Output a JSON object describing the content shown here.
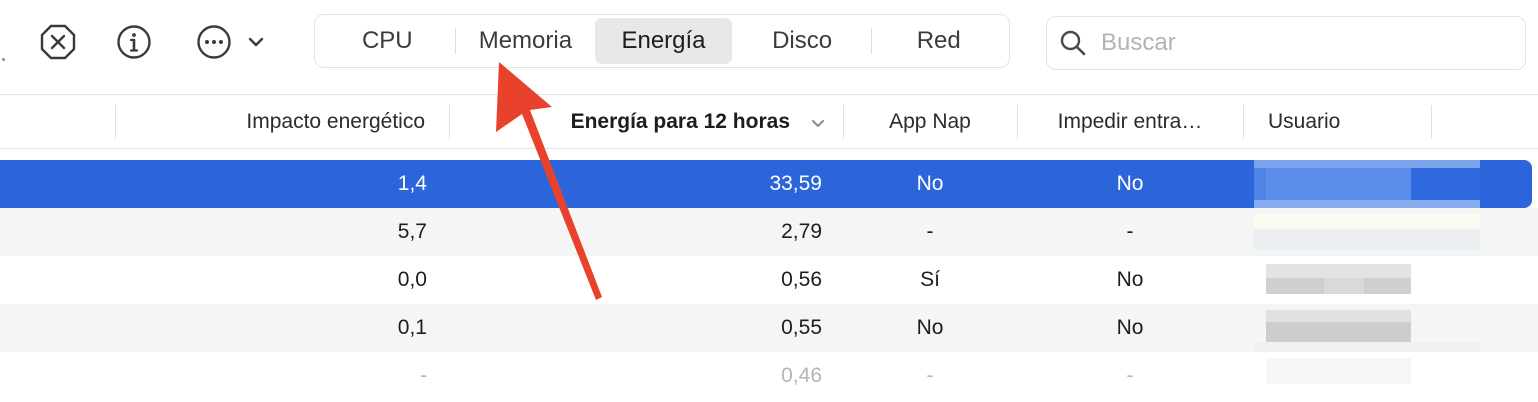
{
  "toolbar": {
    "stop_icon": "stop-process-icon",
    "info_icon": "info-icon",
    "more_icon": "more-icon",
    "tabs": [
      {
        "label": "CPU",
        "active": false
      },
      {
        "label": "Memoria",
        "active": false
      },
      {
        "label": "Energía",
        "active": true
      },
      {
        "label": "Disco",
        "active": false
      },
      {
        "label": "Red",
        "active": false
      }
    ],
    "search_placeholder": "Buscar"
  },
  "table": {
    "columns": {
      "energy_impact": "Impacto energético",
      "energy_12h": "Energía para 12 horas",
      "app_nap": "App Nap",
      "prevent_sleep": "Impedir entra…",
      "user": "Usuario"
    },
    "rows": [
      {
        "impact": "1,4",
        "energy": "33,59",
        "app_nap": "No",
        "prevent": "No"
      },
      {
        "impact": "5,7",
        "energy": "2,79",
        "app_nap": "-",
        "prevent": "-"
      },
      {
        "impact": "0,0",
        "energy": "0,56",
        "app_nap": "Sí",
        "prevent": "No"
      },
      {
        "impact": "0,1",
        "energy": "0,55",
        "app_nap": "No",
        "prevent": "No"
      },
      {
        "impact": "-",
        "energy": "0,46",
        "app_nap": "-",
        "prevent": "-"
      }
    ]
  },
  "colors": {
    "selection": "#2b65d9",
    "annotation_arrow": "#e8412c"
  }
}
